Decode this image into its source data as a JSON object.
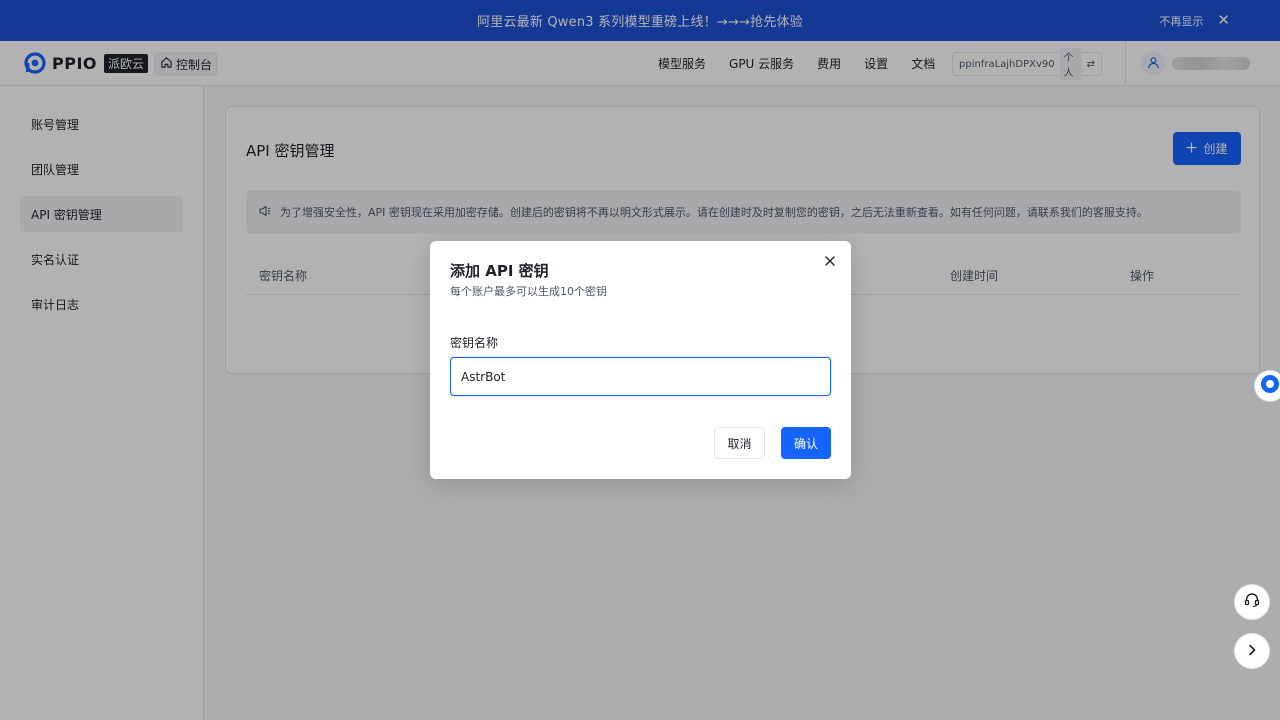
{
  "banner": {
    "text": "阿里云最新 Qwen3 系列模型重磅上线！→→→抢先体验",
    "dismiss_label": "不再显示"
  },
  "header": {
    "logo_text": "PPIO",
    "logo_badge": "派欧云",
    "console_label": "控制台",
    "nav": [
      "模型服务",
      "GPU 云服务",
      "费用",
      "设置",
      "文档"
    ],
    "account_id": "ppinfraLajhDPXv90",
    "account_type": "个人"
  },
  "sidebar": {
    "items": [
      {
        "label": "账号管理",
        "active": false
      },
      {
        "label": "团队管理",
        "active": false
      },
      {
        "label": "API 密钥管理",
        "active": true
      },
      {
        "label": "实名认证",
        "active": false
      },
      {
        "label": "审计日志",
        "active": false
      }
    ]
  },
  "main": {
    "title": "API 密钥管理",
    "create_label": "创建",
    "notice": "为了增强安全性，API 密钥现在采用加密存储。创建后的密钥将不再以明文形式展示。请在创建时及时复制您的密钥，之后无法重新查看。如有任何问题，请联系我们的客服支持。",
    "columns": [
      "密钥名称",
      "创建时间",
      "操作"
    ]
  },
  "modal": {
    "title": "添加 API 密钥",
    "subtitle": "每个账户最多可以生成10个密钥",
    "field_label": "密钥名称",
    "input_value": "AstrBot",
    "cancel_label": "取消",
    "confirm_label": "确认"
  },
  "colors": {
    "primary": "#1664ff",
    "banner": "#1d52d6"
  }
}
